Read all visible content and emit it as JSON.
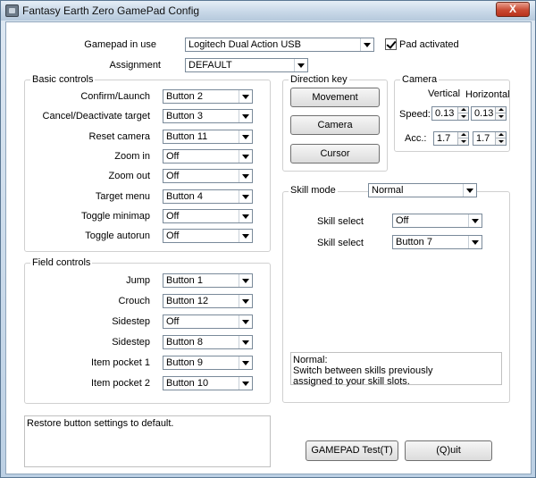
{
  "window": {
    "title": "Fantasy Earth Zero GamePad Config",
    "close_label": "X"
  },
  "gamepad": {
    "label": "Gamepad in use",
    "value": "Logitech Dual Action USB",
    "pad_activated_label": "Pad activated",
    "pad_activated_checked": true
  },
  "assignment": {
    "label": "Assignment",
    "value": "DEFAULT"
  },
  "basic_controls": {
    "title": "Basic controls",
    "rows": [
      {
        "label": "Confirm/Launch",
        "value": "Button 2"
      },
      {
        "label": "Cancel/Deactivate target",
        "value": "Button 3"
      },
      {
        "label": "Reset camera",
        "value": "Button 11"
      },
      {
        "label": "Zoom in",
        "value": "Off"
      },
      {
        "label": "Zoom out",
        "value": "Off"
      },
      {
        "label": "Target menu",
        "value": "Button 4"
      },
      {
        "label": "Toggle minimap",
        "value": "Off"
      },
      {
        "label": "Toggle autorun",
        "value": "Off"
      }
    ]
  },
  "field_controls": {
    "title": "Field controls",
    "rows": [
      {
        "label": "Jump",
        "value": "Button 1"
      },
      {
        "label": "Crouch",
        "value": "Button 12"
      },
      {
        "label": "Sidestep",
        "value": "Off"
      },
      {
        "label": "Sidestep",
        "value": "Button 8"
      },
      {
        "label": "Item pocket 1",
        "value": "Button 9"
      },
      {
        "label": "Item pocket 2",
        "value": "Button 10"
      }
    ]
  },
  "direction_key": {
    "title": "Direction key",
    "buttons": [
      "Movement",
      "Camera",
      "Cursor"
    ]
  },
  "camera": {
    "title": "Camera",
    "vertical_label": "Vertical",
    "horizontal_label": "Horizontal",
    "speed_label": "Speed:",
    "acc_label": "Acc.:",
    "speed_vertical": "0.13",
    "speed_horizontal": "0.13",
    "acc_vertical": "1.7",
    "acc_horizontal": "1.7"
  },
  "skill_mode": {
    "label": "Skill mode",
    "value": "Normal",
    "rows": [
      {
        "label": "Skill select",
        "value": "Off"
      },
      {
        "label": "Skill select",
        "value": "Button 7"
      }
    ],
    "description": "Normal:\nSwitch between skills previously\nassigned to your skill slots."
  },
  "status": {
    "text": "Restore button settings to default."
  },
  "footer": {
    "test_label": "GAMEPAD Test(T)",
    "quit_label": "(Q)uit"
  }
}
